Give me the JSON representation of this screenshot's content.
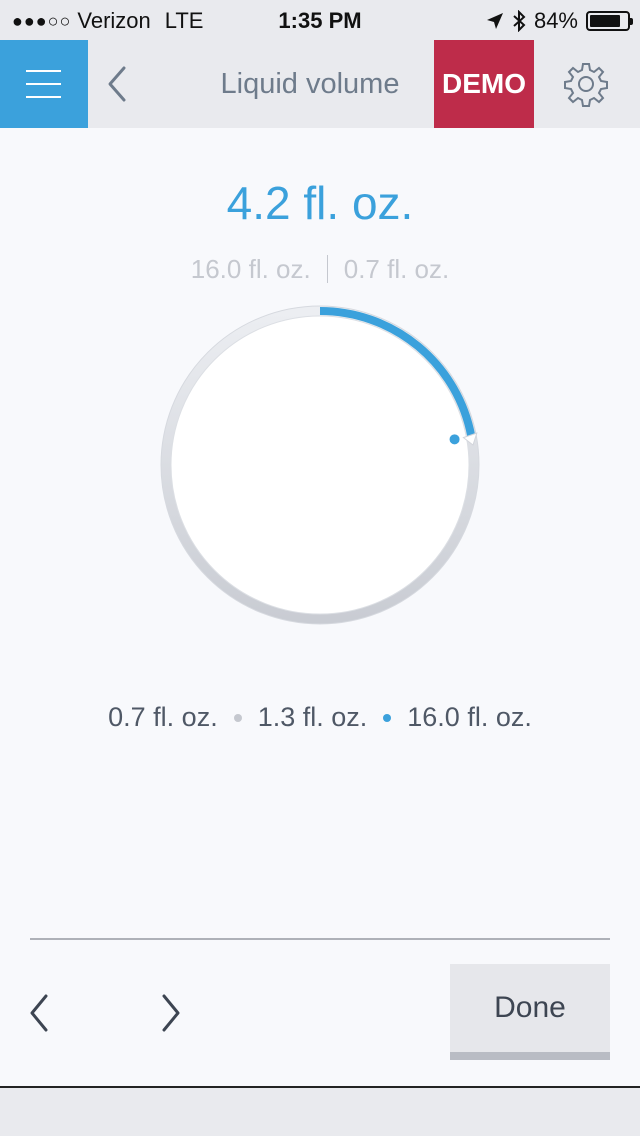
{
  "status_bar": {
    "signal": "●●●○○",
    "carrier": "Verizon",
    "network": "LTE",
    "time": "1:35 PM",
    "battery_text": "84%",
    "battery_level": 0.84
  },
  "nav": {
    "title": "Liquid volume",
    "demo_label": "DEMO",
    "accent_color": "#3ba1dc",
    "demo_color": "#be2c4a"
  },
  "dial": {
    "value": "4.2 fl. oz.",
    "max_label": "16.0 fl. oz.",
    "min_label": "0.7 fl. oz.",
    "fill_fraction": 0.22
  },
  "presets": [
    {
      "label": "0.7 fl. oz.",
      "dot_color": "#c5c8cf"
    },
    {
      "label": "1.3 fl. oz.",
      "dot_color": "#3ba1dc"
    },
    {
      "label": "16.0 fl. oz."
    }
  ],
  "footer": {
    "done_label": "Done"
  }
}
